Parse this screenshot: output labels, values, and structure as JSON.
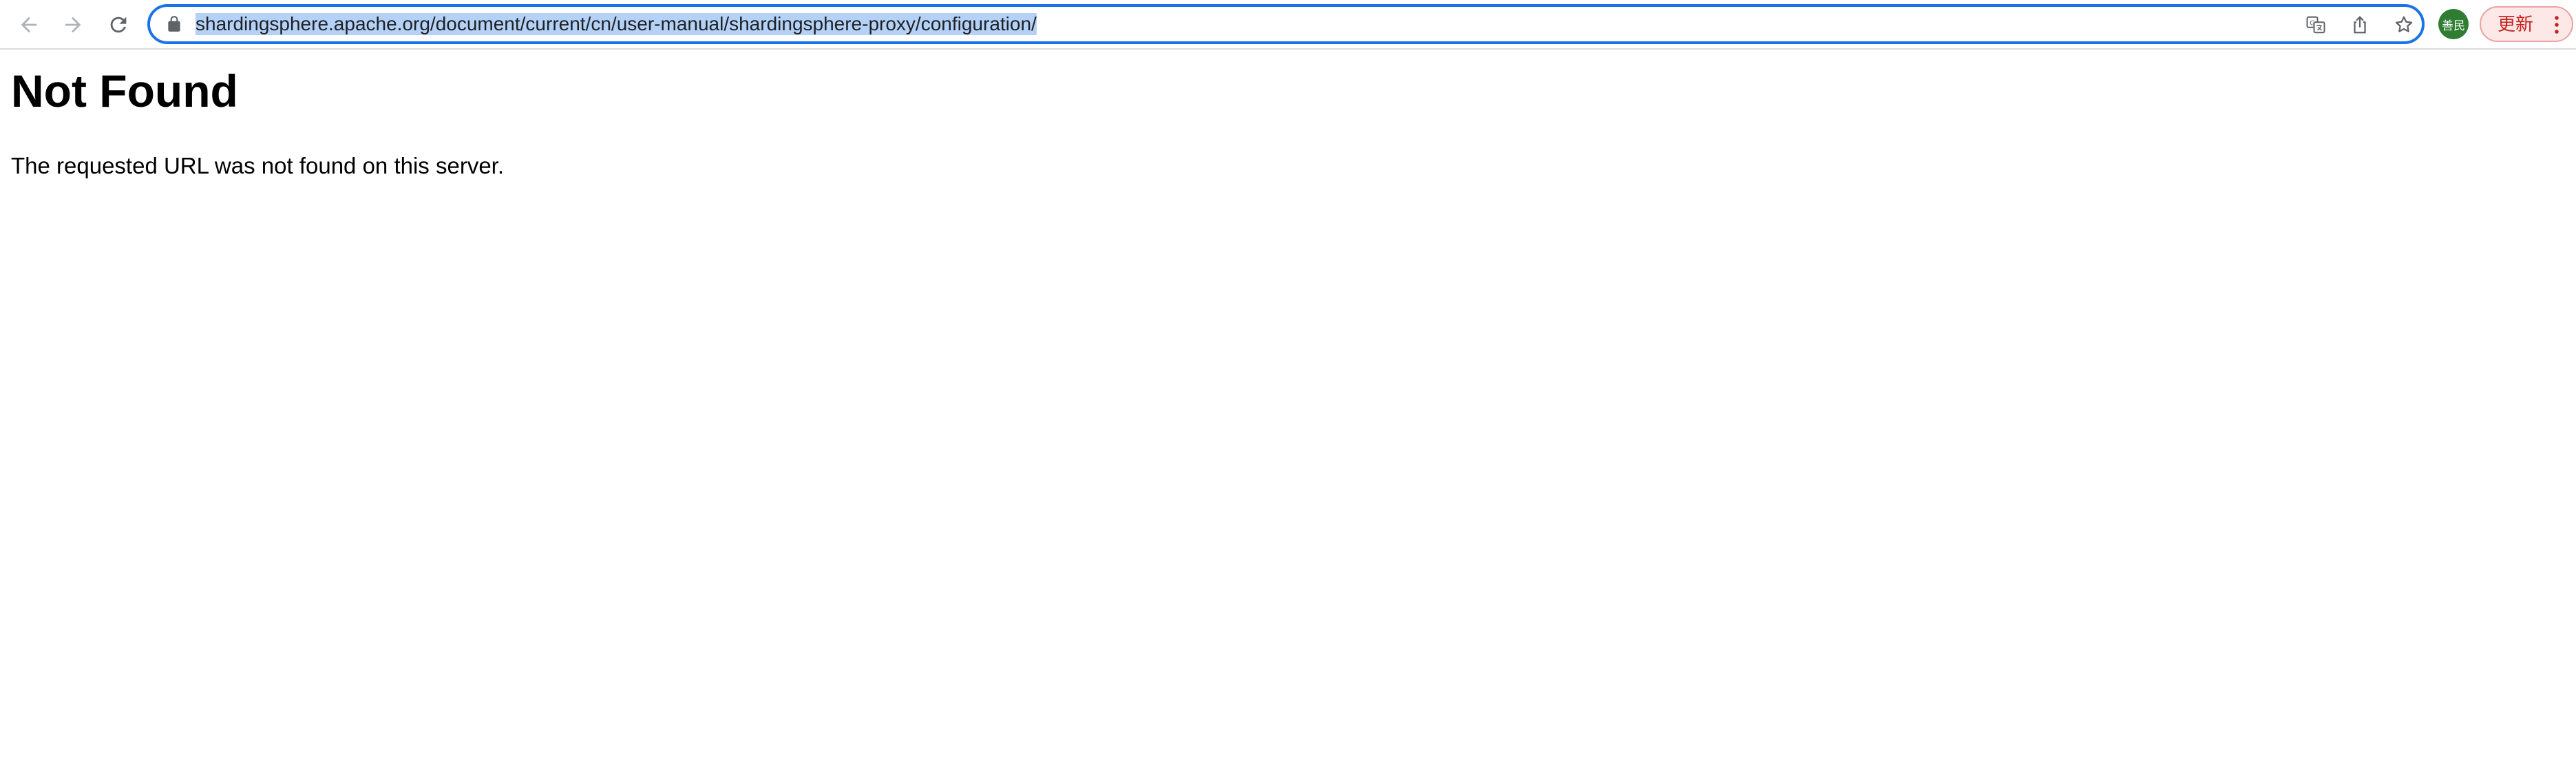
{
  "browser": {
    "url": "shardingsphere.apache.org/document/current/cn/user-manual/shardingsphere-proxy/configuration/",
    "nav_icons": [
      "back-arrow-icon",
      "forward-arrow-icon",
      "reload-icon"
    ],
    "omnibox_icons": [
      "lock-icon",
      "translate-icon",
      "share-icon",
      "bookmark-star-icon"
    ],
    "profile_avatar_text": "善民",
    "update_button_label": "更新",
    "accent_color": "#1a73e8",
    "selection_color": "#b4d2f7",
    "update_color": "#c5221f"
  },
  "page": {
    "heading": "Not Found",
    "message": "The requested URL was not found on this server."
  }
}
